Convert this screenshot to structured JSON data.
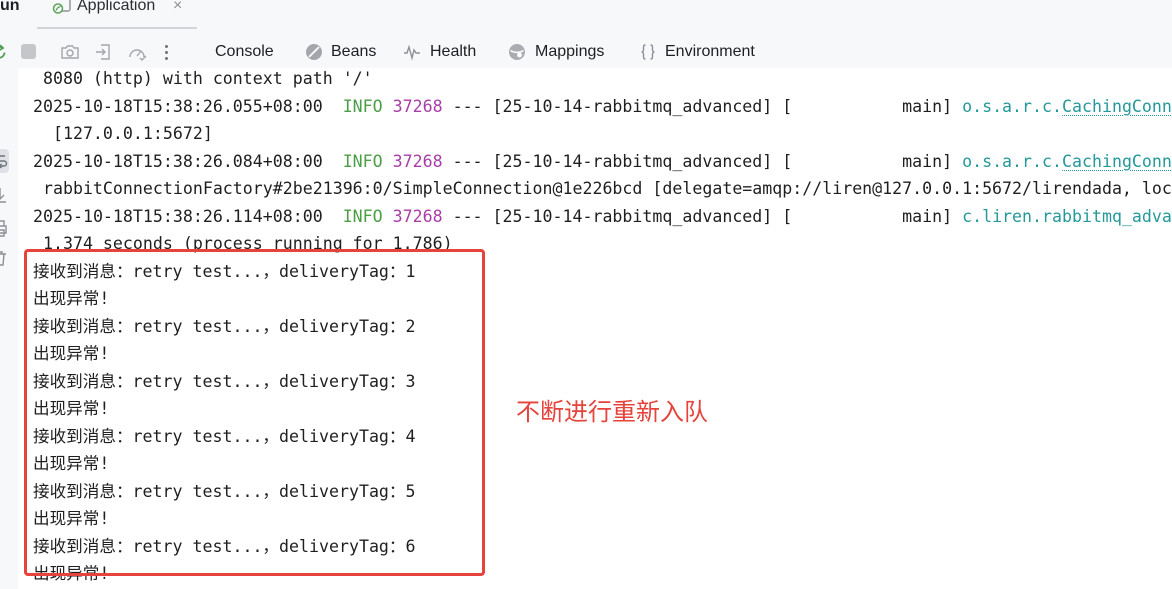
{
  "run_window": {
    "title": "un",
    "tab": {
      "label": "Application",
      "icon": "spring-boot-app-icon",
      "close": "×"
    }
  },
  "toolbar": {
    "action_icons": [
      "rerun-icon",
      "stop-icon",
      "camera-icon",
      "exit-icon",
      "gauge-icon",
      "more-options-icon"
    ],
    "tabs": [
      {
        "label": "Console",
        "selected": true
      },
      {
        "label": "Beans",
        "icon": "beans-icon"
      },
      {
        "label": "Health",
        "icon": "health-pulse-icon"
      },
      {
        "label": "Mappings",
        "icon": "mappings-globe-icon"
      },
      {
        "label": "Environment",
        "icon": "environment-braces-icon"
      }
    ]
  },
  "side_toolbar": {
    "icons": [
      "soft-wrap-icon",
      "scroll-to-end-icon",
      "print-icon",
      "clear-all-icon"
    ]
  },
  "console": {
    "lines": [
      {
        "text": "8080 (http) with context path '/'"
      },
      {
        "timestamp": "2025-10-18T15:38:26.055+08:00",
        "level": "INFO",
        "pid": "37268",
        "separator": "---",
        "app": "[25-10-14-rabbitmq_advanced]",
        "thread": "[           main]",
        "logger": "o.s.a.r.c.",
        "logger_link": "CachingConn"
      },
      {
        "text": "[127.0.0.1:5672]"
      },
      {
        "timestamp": "2025-10-18T15:38:26.084+08:00",
        "level": "INFO",
        "pid": "37268",
        "separator": "---",
        "app": "[25-10-14-rabbitmq_advanced]",
        "thread": "[           main]",
        "logger": "o.s.a.r.c.",
        "logger_link": "CachingConn"
      },
      {
        "text": "rabbitConnectionFactory#2be21396:0/SimpleConnection@1e226bcd [delegate=amqp://liren@127.0.0.1:5672/lirendada, loc"
      },
      {
        "timestamp": "2025-10-18T15:38:26.114+08:00",
        "level": "INFO",
        "pid": "37268",
        "separator": "---",
        "app": "[25-10-14-rabbitmq_advanced]",
        "thread": "[           main]",
        "logger": "c.liren.rabbitmq_adva"
      },
      {
        "text": "1.374 seconds (process running for 1.786)"
      },
      {
        "text": "接收到消息：retry test...，deliveryTag：1"
      },
      {
        "text": "出现异常!"
      },
      {
        "text": "接收到消息：retry test...，deliveryTag：2"
      },
      {
        "text": "出现异常!"
      },
      {
        "text": "接收到消息：retry test...，deliveryTag：3"
      },
      {
        "text": "出现异常!"
      },
      {
        "text": "接收到消息：retry test...，deliveryTag：4"
      },
      {
        "text": "出现异常!"
      },
      {
        "text": "接收到消息：retry test...，deliveryTag：5"
      },
      {
        "text": "出现异常!"
      },
      {
        "text": "接收到消息：retry test...，deliveryTag：6"
      },
      {
        "text": "出现异常!"
      }
    ]
  },
  "annotation": {
    "text": "不断进行重新入队"
  },
  "colors": {
    "log_level_info": "#4c9e45",
    "process_id": "#a93da8",
    "logger_name": "#24999b",
    "annotation_red": "#e5433b",
    "console_text": "#1f1f1f",
    "run_green": "#4f9d4f"
  }
}
